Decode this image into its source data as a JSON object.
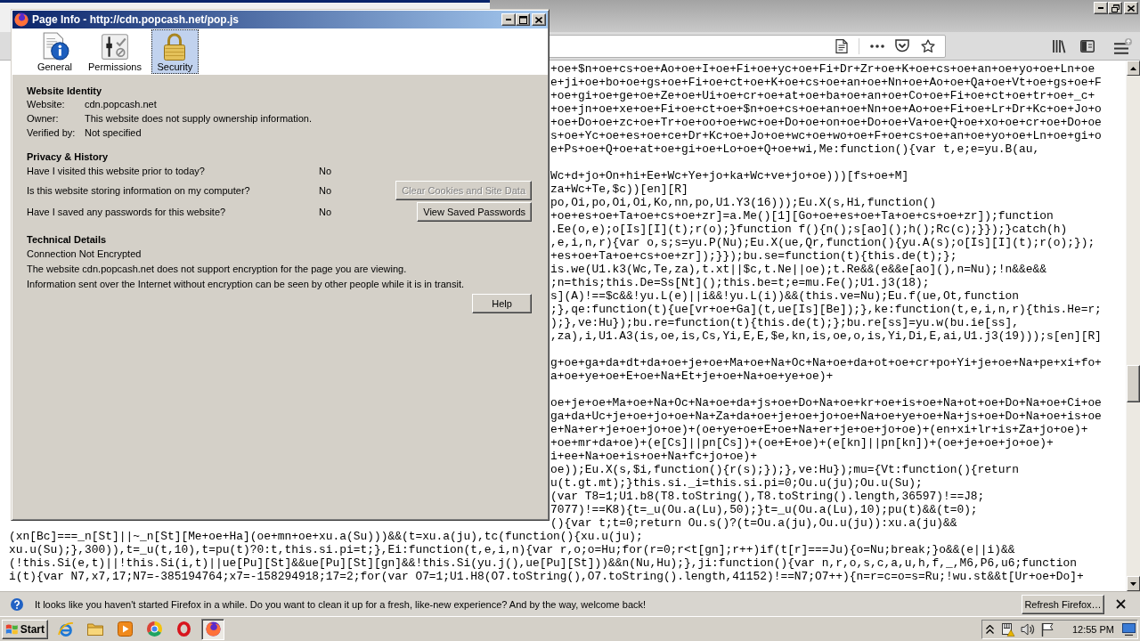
{
  "dialog": {
    "title": "Page Info - http://cdn.popcash.net/pop.js",
    "tabs": [
      {
        "label": "General",
        "selected": false
      },
      {
        "label": "Permissions",
        "selected": false
      },
      {
        "label": "Security",
        "selected": true
      }
    ],
    "website_identity": {
      "heading": "Website Identity",
      "rows": [
        {
          "label": "Website:",
          "value": "cdn.popcash.net"
        },
        {
          "label": "Owner:",
          "value": "This website does not supply ownership information."
        },
        {
          "label": "Verified by:",
          "value": "Not specified"
        }
      ]
    },
    "privacy_history": {
      "heading": "Privacy & History",
      "rows": [
        {
          "question": "Have I visited this website prior to today?",
          "answer": "No"
        },
        {
          "question": "Is this website storing information on my computer?",
          "answer": "No",
          "button": {
            "label": "Clear Cookies and Site Data",
            "disabled": true
          }
        },
        {
          "question": "Have I saved any passwords for this website?",
          "answer": "No",
          "button": {
            "label": "View Saved Passwords",
            "disabled": false
          }
        }
      ]
    },
    "technical_details": {
      "heading": "Technical Details",
      "lines": [
        "Connection Not Encrypted",
        "The website cdn.popcash.net does not support encryption for the page you are viewing.",
        "Information sent over the Internet without encryption can be seen by other people while it is in transit."
      ]
    },
    "help_button": "Help"
  },
  "source_view": {
    "blocks_beside_dialog": [
      [
        "+oe+$n+oe+cs+oe+Ao+oe+I+oe+Fi+oe+yc+oe+Fi+Dr+Zr+oe+K+oe+cs+oe+an+oe+yo+oe+Ln+oe",
        "e+ji+oe+bo+oe+gs+oe+Fi+oe+ct+oe+K+oe+cs+oe+an+oe+Nn+oe+Ao+oe+Qa+oe+Vt+oe+gs+oe+F",
        "+oe+gi+oe+ge+oe+Ze+oe+Ui+oe+cr+oe+at+oe+ba+oe+an+oe+Co+oe+Fi+oe+ct+oe+tr+oe+_c+",
        "+oe+jn+oe+xe+oe+Fi+oe+ct+oe+$n+oe+cs+oe+an+oe+Nn+oe+Ao+oe+Fi+oe+Lr+Dr+Kc+oe+Jo+o",
        "+oe+Do+oe+zc+oe+Tr+oe+oo+oe+wc+oe+Do+oe+on+oe+Do+oe+Va+oe+Q+oe+xo+oe+cr+oe+Do+oe",
        "s+oe+Yc+oe+es+oe+ce+Dr+Kc+oe+Jo+oe+wc+oe+wo+oe+F+oe+cs+oe+an+oe+yo+oe+Ln+oe+gi+o",
        "e+Ps+oe+Q+oe+at+oe+gi+oe+Lo+oe+Q+oe+wi,Me:function(){var t,e;e=yu.B(au,"
      ],
      [
        "Wc+d+jo+On+hi+Ee+Wc+Ye+jo+ka+Wc+ve+jo+oe)))[fs+oe+M]",
        "za+Wc+Te,$c))[en][R]",
        "po,Oi,po,Oi,Oi,Ko,nn,po,U1.Y3(16)));Eu.X(s,Hi,function()",
        "+oe+es+oe+Ta+oe+cs+oe+zr]=a.Me()[1][Go+oe+es+oe+Ta+oe+cs+oe+zr]);function",
        ".Ee(o,e);o[Is][I](t);r(o);}function f(){n();s[ao]();h();Rc(c);}});}catch(h)",
        ",e,i,n,r){var o,s;s=yu.P(Nu);Eu.X(ue,Qr,function(){yu.A(s);o[Is][I](t);r(o);});",
        "+es+oe+Ta+oe+cs+oe+zr]);}});bu.se=function(t){this.de(t);};",
        "is.we(U1.k3(Wc,Te,za),t.xt||$c,t.Ne||oe);t.Re&&(e&&e[ao](),n=Nu);!n&&e&&",
        ";n=this;this.De=Ss[Nt]();this.be=t;e=mu.Fe();U1.j3(18);",
        "s](A)!==$c&&!yu.L(e)||i&&!yu.L(i))&&(this.ve=Nu);Eu.f(ue,Ot,function",
        ";},qe:function(t){ue[vr+oe+Ga](t,ue[Is][Be]);},ke:function(t,e,i,n,r){this.He=r;",
        ");},ve:Hu});bu.re=function(t){this.de(t);};bu.re[ss]=yu.w(bu.ie[ss],",
        ",za),i,U1.A3(is,oe,is,Cs,Yi,E,E,$e,kn,is,oe,o,is,Yi,Di,E,ai,U1.j3(19)));s[en][R]"
      ],
      [
        "g+oe+ga+da+dt+da+oe+je+oe+Ma+oe+Na+Oc+Na+oe+da+ot+oe+cr+po+Yi+je+oe+Na+pe+xi+fo+",
        "a+oe+ye+oe+E+oe+Na+Et+je+oe+Na+oe+ye+oe)+"
      ],
      [
        "oe+je+oe+Ma+oe+Na+Oc+Na+oe+da+js+oe+Do+Na+oe+kr+oe+is+oe+Na+ot+oe+Do+Na+oe+Ci+oe",
        "ga+da+Uc+je+oe+jo+oe+Na+Za+da+oe+je+oe+jo+oe+Na+oe+ye+oe+Na+js+oe+Do+Na+oe+is+oe",
        "e+Na+er+je+oe+jo+oe)+(oe+ye+oe+E+oe+Na+er+je+oe+jo+oe)+(en+xi+lr+is+Za+jo+oe)+",
        "+oe+mr+da+oe)+(e[Cs]||pn[Cs])+(oe+E+oe)+(e[kn]||pn[kn])+(oe+je+oe+jo+oe)+",
        "i+ee+Na+oe+is+oe+Na+fc+jo+oe)+",
        "oe));Eu.X(s,$i,function(){r(s);});},ve:Hu});mu={Vt:function(){return",
        "u(t.gt.mt);}this.si._i=this.si.pi=0;Ou.u(ju);Ou.u(Su);",
        "(var T8=1;U1.b8(T8.toString(),T8.toString().length,36597)!==J8;",
        "7077)!==K8){t=_u(Ou.a(Lu),50);}t=_u(Ou.a(Lu),10);pu(t)&&(t=0);",
        "(){var t;t=0;return Ou.s()?(t=Ou.a(ju),Ou.u(ju)):xu.a(ju)&&"
      ]
    ],
    "lines_below_dialog": [
      "(xn[Bc]===_n[St]||~_n[St][Me+oe+Ha](oe+mn+oe+xu.a(Su)))&&(t=xu.a(ju),tc(function(){xu.u(ju);",
      "xu.u(Su);},300)),t=_u(t,10),t=pu(t)?0:t,this.si.pi=t;},Ei:function(t,e,i,n){var r,o;o=Hu;for(r=0;r<t[gn];r++)if(t[r]===Ju){o=Nu;break;}o&&(e||i)&&",
      "(!this.Si(e,t)||!this.Si(i,t)||ue[Pu][St]&&ue[Pu][St][gn]&&!this.Si(yu.j(),ue[Pu][St]))&&n(Nu,Hu);},ji:function(){var n,r,o,s,c,a,u,h,f,_,M6,P6,u6;function",
      "i(t){var N7,x7,17;N7=-385194764;x7=-158294918;17=2;for(var O7=1;U1.H8(O7.toString(),O7.toString().length,41152)!==N7;O7++){n=r=c=o=s=Ru;!wu.st&&t[Ur+oe+Do]+"
    ]
  },
  "notification": {
    "message": "It looks like you haven't started Firefox in a while. Do you want to clean it up for a fresh, like-new experience? And by the way, welcome back!",
    "button": "Refresh Firefox…"
  },
  "taskbar": {
    "start": "Start",
    "buttons": [
      {
        "selected": false
      },
      {
        "selected": false
      },
      {
        "selected": false
      },
      {
        "selected": false
      },
      {
        "selected": false
      },
      {
        "selected": true
      }
    ],
    "clock": "12:55 PM"
  }
}
